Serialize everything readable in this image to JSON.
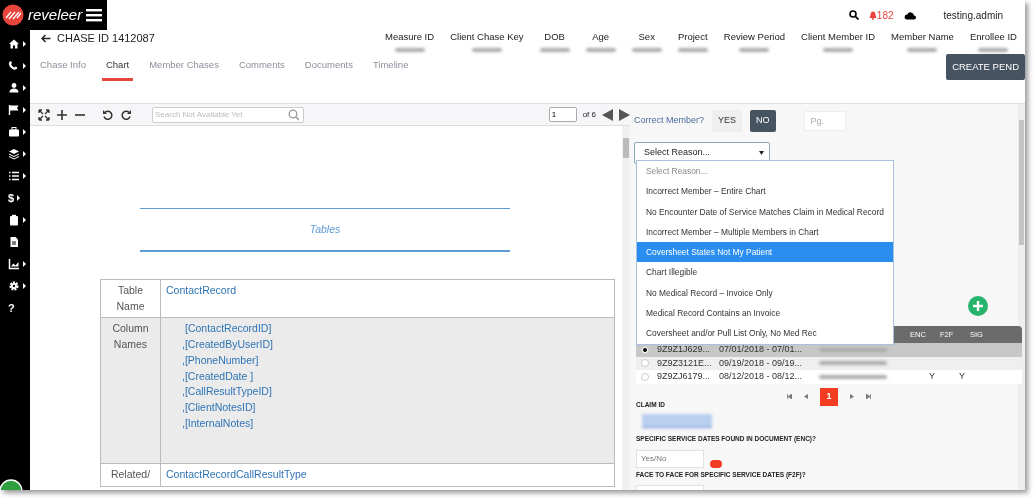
{
  "brand": {
    "name": "reveleer"
  },
  "topbar": {
    "notifications": "182",
    "user": "testing.admin"
  },
  "sidebar": {
    "items": [
      {
        "kind": "icon"
      },
      {
        "kind": "icon"
      },
      {
        "kind": "icon"
      },
      {
        "kind": "icon"
      },
      {
        "kind": "icon"
      },
      {
        "kind": "icon"
      },
      {
        "kind": "icon"
      },
      {
        "kind": "glyph",
        "text": "$"
      },
      {
        "kind": "icon"
      },
      {
        "kind": "icon"
      },
      {
        "kind": "icon"
      },
      {
        "kind": "icon"
      },
      {
        "kind": "glyph",
        "text": "?"
      }
    ]
  },
  "chase": {
    "title": "CHASE ID 1412087",
    "columns": [
      "Measure ID",
      "Client Chase Key",
      "DOB",
      "Age",
      "Sex",
      "Project",
      "Review Period",
      "Client Member ID",
      "Member Name",
      "Enrollee ID"
    ]
  },
  "tabs": [
    {
      "label": "Chase Info",
      "selected": false
    },
    {
      "label": "Chart",
      "selected": true
    },
    {
      "label": "Member Chases",
      "selected": false
    },
    {
      "label": "Comments",
      "selected": false
    },
    {
      "label": "Documents",
      "selected": false
    },
    {
      "label": "Timeline",
      "selected": false
    }
  ],
  "create_button": "CREATE PEND",
  "viewer": {
    "search_placeholder": "Search Not Available Yet",
    "page": "1",
    "page_count": "of 6"
  },
  "document": {
    "heading": "Tables",
    "rows": [
      {
        "label": "Table Name",
        "values": [
          "ContactRecord"
        ]
      },
      {
        "label": "Column Names",
        "values": [
          "[ContactRecordID]",
          ",[CreatedByUserID]",
          ",[PhoneNumber]",
          ",[CreatedDate ]",
          ",[CallResultTypeID]",
          ",[ClientNotesID]",
          ",[InternalNotes]"
        ]
      },
      {
        "label": "Related/",
        "values": [
          "ContactRecordCallResultType"
        ]
      }
    ]
  },
  "correct_member": {
    "label": "Correct Member?",
    "options": [
      {
        "label": "YES",
        "selected": false
      },
      {
        "label": "NO",
        "selected": true
      }
    ],
    "page_placeholder": "Pg."
  },
  "reason_select": {
    "value": "Select Reason...",
    "options": [
      {
        "label": "Select Reason...",
        "highlighted": false,
        "placeholder": true
      },
      {
        "label": "Incorrect Member – Entire Chart",
        "highlighted": false
      },
      {
        "label": "No Encounter Date of Service Matches Claim in Medical Record",
        "highlighted": false
      },
      {
        "label": "Incorrect Member – Multiple Members in Chart",
        "highlighted": false
      },
      {
        "label": "Coversheet States Not My Patient",
        "highlighted": true
      },
      {
        "label": "Chart Illegible",
        "highlighted": false
      },
      {
        "label": "No Medical Record – Invoice Only",
        "highlighted": false
      },
      {
        "label": "Medical Record Contains an Invoice",
        "highlighted": false
      },
      {
        "label": "Coversheet and/or Pull List Only, No Med Rec",
        "highlighted": false
      }
    ]
  },
  "encounters": {
    "columns": [
      "ENC",
      "F2F",
      "SIG"
    ],
    "rows": [
      {
        "id": "9Z9Z1J629...",
        "dates": "07/01/2018 - 07/01...",
        "enc": "",
        "f2f": "",
        "selected": true
      },
      {
        "id": "9Z9Z3121E...",
        "dates": "09/19/2018 - 09/19...",
        "enc": "",
        "f2f": "",
        "selected": false
      },
      {
        "id": "9Z9ZJ6179...",
        "dates": "08/12/2018 - 08/12...",
        "enc": "Y",
        "f2f": "Y",
        "selected": false
      }
    ],
    "current_page": "1"
  },
  "form": {
    "claim_label": "CLAIM ID",
    "enc_label": "SPECIFIC SERVICE DATES FOUND IN DOCUMENT (ENC)?",
    "enc_placeholder": "Yes/No",
    "f2f_label": "FACE TO FACE FOR SPECIFIC SERVICE DATES (F2F)?"
  }
}
